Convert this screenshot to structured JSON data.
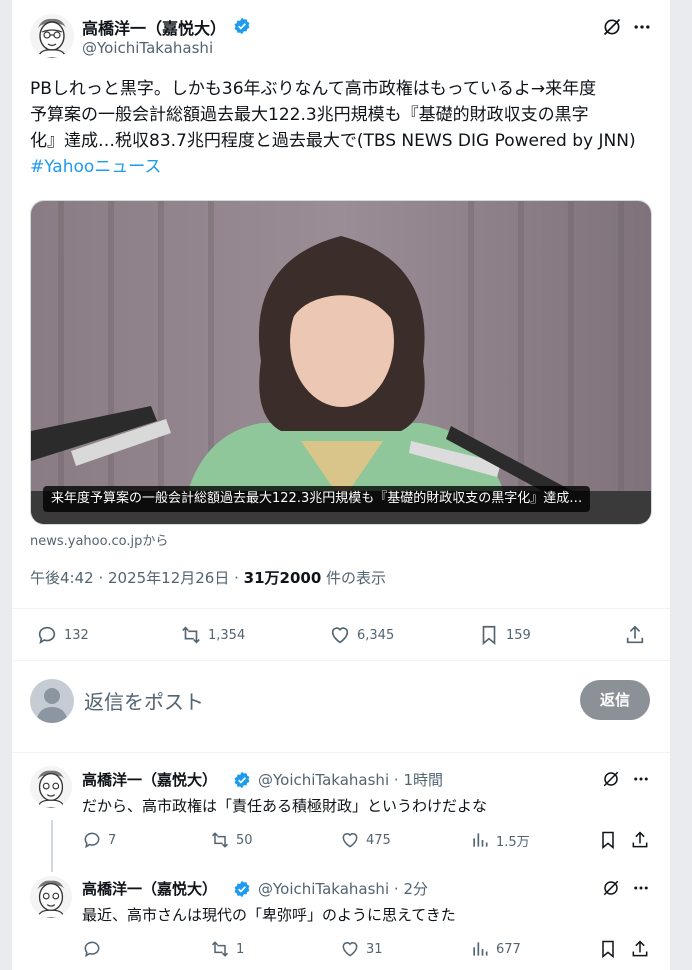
{
  "tweet": {
    "author_name": "高橋洋一（嘉悦大）",
    "author_handle": "@YoichiTakahashi",
    "text_lines": [
      "PBしれっと黒字。しかも36年ぶりなんて高市政権はもっているよ→来年度",
      "予算案の一般会計総額過去最大122.3兆円規模も『基礎的財政収支の黒字",
      "化』達成…税収83.7兆円程度と過去最大で(TBS NEWS DIG Powered by JNN)"
    ],
    "hashtag": "#Yahooニュース",
    "media_caption": "来年度予算案の一般会計総額過去最大122.3兆円規模も『基礎的財政収支の黒字化』達成…",
    "source": "news.yahoo.co.jpから",
    "timestamp": "午後4:42 · 2025年12月26日 · ",
    "views_count": "31万2000",
    "views_suffix": " 件の表示",
    "replies": "132",
    "retweets": "1,354",
    "likes": "6,345",
    "bookmarks": "159"
  },
  "reply_box": {
    "placeholder": "返信をポスト",
    "button_label": "返信"
  },
  "replies": [
    {
      "author_name": "高橋洋一（嘉悦大）",
      "author_handle": "@YoichiTakahashi",
      "time": "1時間",
      "text": "だから、高市政権は「責任ある積極財政」というわけだよな",
      "replies": "7",
      "retweets": "50",
      "likes": "475",
      "views": "1.5万"
    },
    {
      "author_name": "高橋洋一（嘉悦大）",
      "author_handle": "@YoichiTakahashi",
      "time": "2分",
      "text": "最近、高市さんは現代の「卑弥呼」のように思えてきた",
      "replies": "",
      "retweets": "1",
      "likes": "31",
      "views": "677"
    }
  ],
  "colors": {
    "accent": "#1d9bf0",
    "secondary_text": "#536471",
    "reply_button": "#8b9196"
  }
}
